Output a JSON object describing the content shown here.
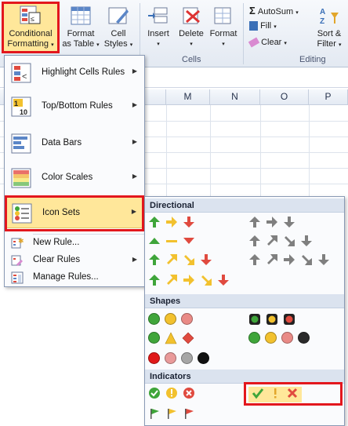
{
  "ribbon": {
    "conditional_formatting_line1": "Conditional",
    "conditional_formatting_line2": "Formatting",
    "format_as_table_line1": "Format",
    "format_as_table_line2": "as Table",
    "cell_styles_line1": "Cell",
    "cell_styles_line2": "Styles",
    "insert": "Insert",
    "delete": "Delete",
    "format": "Format",
    "cells_group": "Cells",
    "autosum": "AutoSum",
    "fill": "Fill",
    "clear": "Clear",
    "sort_filter_line1": "Sort &",
    "sort_filter_line2": "Filter",
    "editing_group": "Editing",
    "dropdown_glyph": "▾"
  },
  "columns": [
    "M",
    "N",
    "O",
    "P"
  ],
  "menu": {
    "highlight_cells_rules": "Highlight Cells Rules",
    "top_bottom_rules": "Top/Bottom Rules",
    "data_bars": "Data Bars",
    "color_scales": "Color Scales",
    "icon_sets": "Icon Sets",
    "new_rule": "New Rule...",
    "clear_rules": "Clear Rules",
    "manage_rules": "Manage Rules...",
    "arrow_glyph": "▶"
  },
  "submenu": {
    "directional": "Directional",
    "shapes": "Shapes",
    "indicators": "Indicators"
  },
  "colors": {
    "accent_red": "#e3171d",
    "green": "#3fa53a",
    "yellow": "#f2c12e",
    "red": "#e04a3f",
    "gray_arrow": "#7f7f7f"
  }
}
